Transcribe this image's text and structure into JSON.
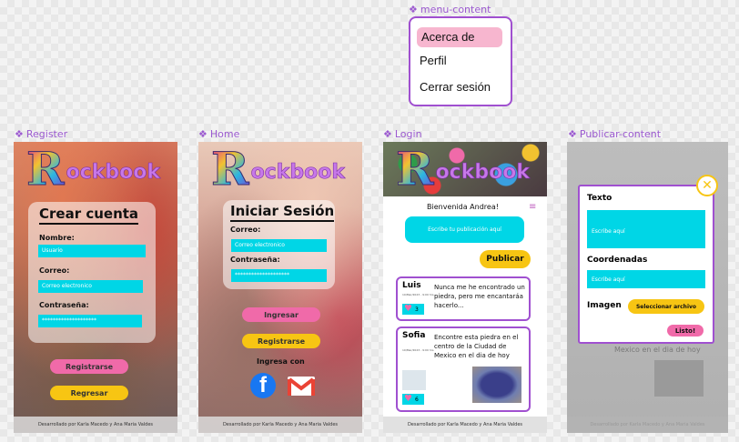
{
  "labels": {
    "menu_content": "menu-content",
    "register": "Register",
    "home": "Home",
    "login": "Login",
    "publicar_content": "Publicar-content"
  },
  "menu": {
    "items": [
      "Acerca de",
      "Perfil",
      "Cerrar sesión"
    ]
  },
  "logo": {
    "first": "R",
    "rest": "ockbook"
  },
  "register": {
    "title": "Crear cuenta",
    "nombre_label": "Nombre:",
    "nombre_value": "Usuario",
    "correo_label": "Correo:",
    "correo_value": "Correo electronico",
    "password_label": "Contraseña:",
    "password_value": "********************",
    "registrarse": "Registrarse",
    "regresar": "Regresar"
  },
  "home": {
    "title": "Iniciar Sesión",
    "correo_label": "Correo:",
    "correo_value": "Correo electronico",
    "password_label": "Contraseña:",
    "password_value": "********************",
    "ingresar": "Ingresar",
    "registrarse": "Registrarse",
    "ingresa_con": "Ingresa con"
  },
  "login": {
    "welcome": "Bienvenida Andrea!",
    "publish_placeholder": "Escribe tu publicación aquí",
    "publicar": "Publicar",
    "posts": [
      {
        "name": "Luis",
        "date": "10/Mar/2023 - 9:00 hrs",
        "text": "Nunca me he encontrado un piedra, pero me encantaráa hacerlo...",
        "likes": "3"
      },
      {
        "name": "Sofia",
        "date": "10/Mar/2023 - 9:00 hrs",
        "text": "Encontre esta piedra en el centro de la Ciudad de Mexico en el dia de hoy",
        "likes": "6"
      }
    ]
  },
  "publicar": {
    "texto_label": "Texto",
    "texto_placeholder": "Escribe aquí",
    "coordenadas_label": "Coordenadas",
    "coordenadas_placeholder": "Escribe aquí",
    "imagen_label": "Imagen",
    "seleccionar": "Seleccionar archivo",
    "listo": "Listo!",
    "bg_text": "Mexico en el dia de hoy"
  },
  "footer": "Desarrollado por Karla Macedo y Ana Maria Valdes"
}
